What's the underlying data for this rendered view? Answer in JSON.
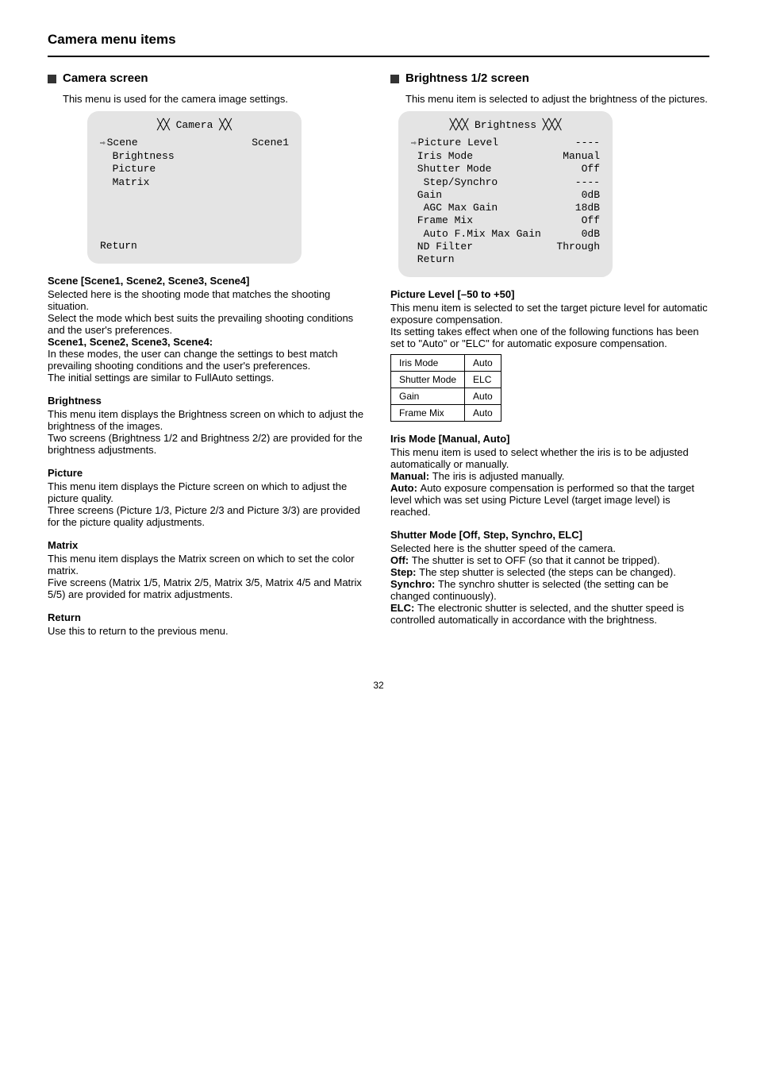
{
  "page_title": "Camera menu items",
  "page_number": "32",
  "left": {
    "heading": "Camera screen",
    "desc": "This menu is used for the camera image settings.",
    "osd": {
      "title": "╳╳ Camera ╳╳",
      "rows": [
        {
          "cursor": true,
          "label": "Scene",
          "value": "Scene1"
        },
        {
          "cursor": false,
          "label": " Brightness",
          "value": ""
        },
        {
          "cursor": false,
          "label": " Picture",
          "value": ""
        },
        {
          "cursor": false,
          "label": " Matrix",
          "value": ""
        }
      ],
      "return": "Return"
    },
    "scene": {
      "title": "Scene [Scene1, Scene2, Scene3, Scene4]",
      "body1": "Selected here is the shooting mode that matches the shooting situation.",
      "body2": "Select the mode which best suits the prevailing shooting conditions and the user's preferences.",
      "list": [
        {
          "label": "Scene1, Scene2, Scene3, Scene4:",
          "text": "In these modes, the user can change the settings to best match prevailing shooting conditions and the user's preferences.\nThe initial settings are similar to FullAuto settings."
        }
      ]
    },
    "brightness": {
      "title": "Brightness",
      "body": "This menu item displays the Brightness screen on which to adjust the brightness of the images.\nTwo screens (Brightness 1/2 and Brightness 2/2) are provided for the brightness adjustments."
    },
    "picture": {
      "title": "Picture",
      "body": "This menu item displays the Picture screen on which to adjust the picture quality.\nThree screens (Picture 1/3, Picture 2/3 and Picture 3/3) are provided for the picture quality adjustments."
    },
    "matrix": {
      "title": "Matrix",
      "body": "This menu item displays the Matrix screen on which to set the color matrix.\nFive screens (Matrix 1/5, Matrix 2/5, Matrix 3/5, Matrix 4/5 and Matrix 5/5) are provided for matrix adjustments."
    },
    "return": {
      "title": "Return",
      "body": "Use this to return to the previous menu."
    }
  },
  "right": {
    "heading": "Brightness 1/2 screen",
    "desc": "This menu item is selected to adjust the brightness of the pictures.",
    "osd": {
      "title": "╳╳╳ Brightness ╳╳╳",
      "rows": [
        {
          "cursor": true,
          "label": "Picture Level",
          "value": "----"
        },
        {
          "cursor": false,
          "label": "Iris Mode",
          "value": "Manual"
        },
        {
          "cursor": false,
          "label": "Shutter Mode",
          "value": "Off"
        },
        {
          "cursor": false,
          "label": " Step/Synchro",
          "value": "----"
        },
        {
          "cursor": false,
          "label": "Gain",
          "value": "0dB"
        },
        {
          "cursor": false,
          "label": " AGC Max Gain",
          "value": "18dB"
        },
        {
          "cursor": false,
          "label": "Frame Mix",
          "value": "Off"
        },
        {
          "cursor": false,
          "label": " Auto F.Mix Max Gain",
          "value": "0dB"
        },
        {
          "cursor": false,
          "label": "ND Filter",
          "value": "Through"
        },
        {
          "cursor": false,
          "label": "Return",
          "value": ""
        }
      ]
    },
    "picture_level": {
      "title": "Picture Level [–50 to +50]",
      "body": "This menu item is selected to set the target picture level for automatic exposure compensation.",
      "body2": "Its setting takes effect when one of the following functions has been set to \"Auto\" or \"ELC\" for automatic exposure compensation.",
      "table_rows": [
        [
          "Iris Mode",
          "Auto"
        ],
        [
          "Shutter Mode",
          "ELC"
        ],
        [
          "Gain",
          "Auto"
        ],
        [
          "Frame Mix",
          "Auto"
        ]
      ]
    },
    "iris_mode": {
      "title": "Iris Mode [Manual, Auto]",
      "body": "This menu item is used to select whether the iris is to be adjusted automatically or manually.",
      "list": [
        {
          "label": "Manual:",
          "text": "The iris is adjusted manually."
        },
        {
          "label": "Auto:",
          "text": "Auto exposure compensation is performed so that the target level which was set using Picture Level (target image level) is reached."
        }
      ]
    },
    "shutter_mode": {
      "title": "Shutter Mode [Off, Step, Synchro, ELC]",
      "body": "Selected here is the shutter speed of the camera.",
      "list": [
        {
          "label": "Off:",
          "text": "The shutter is set to OFF (so that it cannot be tripped)."
        },
        {
          "label": "Step:",
          "text": "The step shutter is selected (the steps can be changed)."
        },
        {
          "label": "Synchro:",
          "text": "The synchro shutter is selected (the setting can be changed continuously)."
        },
        {
          "label": "ELC:",
          "text": "The electronic shutter is selected, and the shutter speed is controlled automatically in accordance with the brightness."
        }
      ]
    }
  }
}
